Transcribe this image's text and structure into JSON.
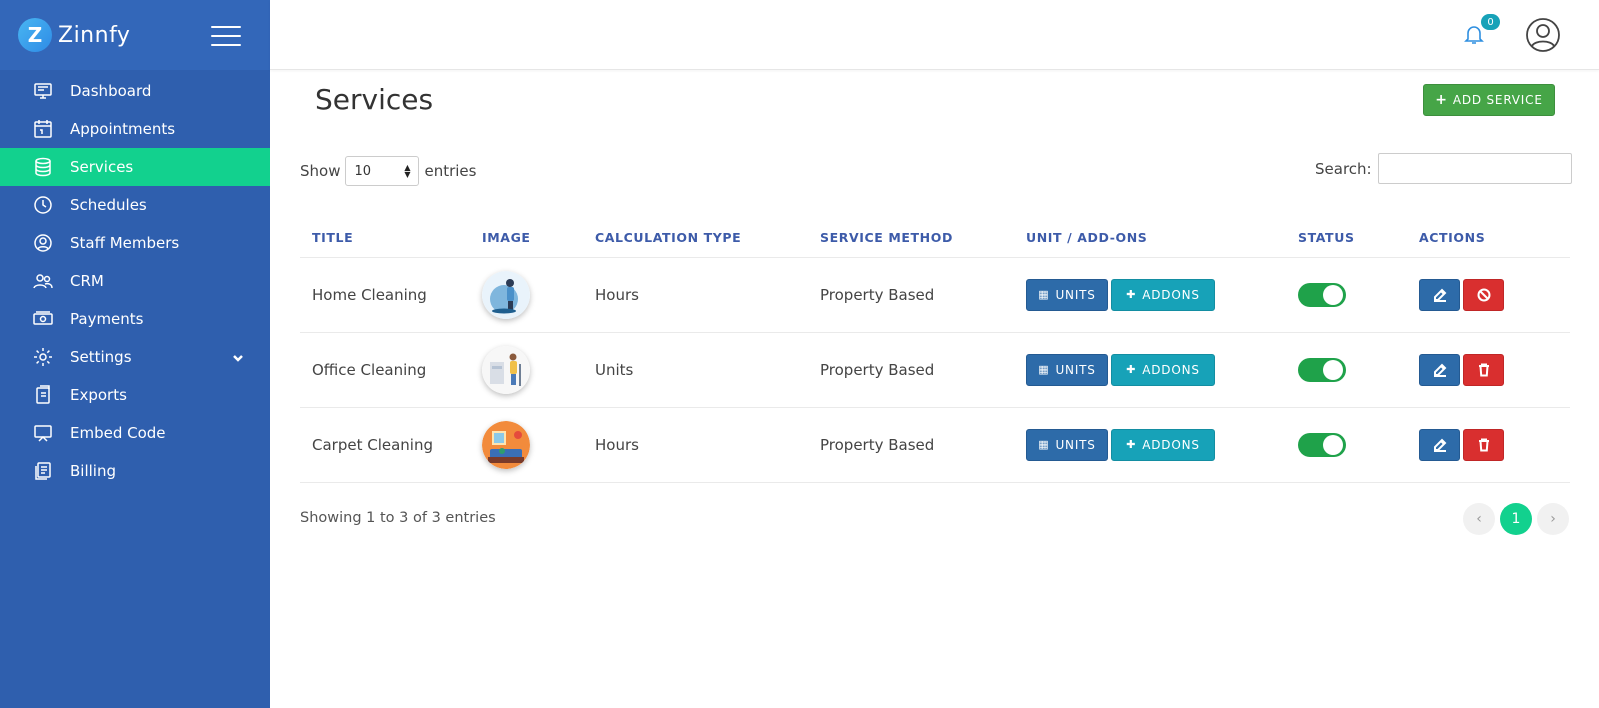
{
  "brand": {
    "logo_letter": "Z",
    "name": "Zinnfy"
  },
  "sidebar": {
    "items": [
      {
        "label": "Dashboard",
        "icon": "monitor-icon"
      },
      {
        "label": "Appointments",
        "icon": "calendar-icon"
      },
      {
        "label": "Services",
        "icon": "database-icon",
        "active": true
      },
      {
        "label": "Schedules",
        "icon": "clock-icon"
      },
      {
        "label": "Staff Members",
        "icon": "user-circle-icon"
      },
      {
        "label": "CRM",
        "icon": "users-icon"
      },
      {
        "label": "Payments",
        "icon": "money-icon"
      },
      {
        "label": "Settings",
        "icon": "gear-icon",
        "has_submenu": true
      },
      {
        "label": "Exports",
        "icon": "export-icon"
      },
      {
        "label": "Embed Code",
        "icon": "screen-icon"
      },
      {
        "label": "Billing",
        "icon": "billing-icon"
      }
    ]
  },
  "header": {
    "notification_count": "0"
  },
  "page": {
    "title": "Services",
    "add_label": "ADD SERVICE",
    "show_label": "Show",
    "entries_value": "10",
    "entries_label": "entries",
    "search_label": "Search:",
    "search_value": ""
  },
  "table": {
    "columns": [
      "TITLE",
      "IMAGE",
      "CALCULATION TYPE",
      "SERVICE METHOD",
      "UNIT / ADD-ONS",
      "STATUS",
      "ACTIONS"
    ],
    "rows": [
      {
        "title": "Home Cleaning",
        "calc": "Hours",
        "method": "Property Based",
        "units_label": "UNITS",
        "addons_label": "ADDONS",
        "status": "on"
      },
      {
        "title": "Office Cleaning",
        "calc": "Units",
        "method": "Property Based",
        "units_label": "UNITS",
        "addons_label": "ADDONS",
        "status": "on"
      },
      {
        "title": "Carpet Cleaning",
        "calc": "Hours",
        "method": "Property Based",
        "units_label": "UNITS",
        "addons_label": "ADDONS",
        "status": "on"
      }
    ]
  },
  "footer": {
    "info": "Showing 1 to 3 of 3 entries",
    "current_page": "1"
  },
  "colors": {
    "sidebar": "#2f5fae",
    "active": "#12d18e",
    "primary": "#2d6ba9",
    "info": "#17a2b8",
    "success": "#46a547",
    "danger": "#d92f2f"
  }
}
